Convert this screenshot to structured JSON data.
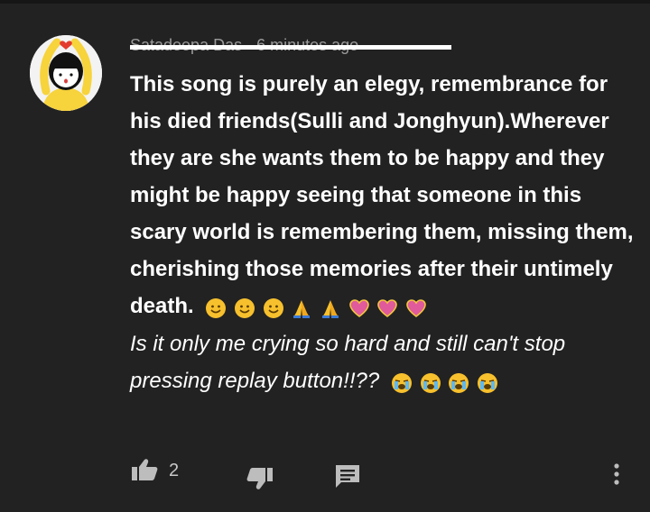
{
  "comment": {
    "author_line": "Satadeepa Das · 6 minutes ago",
    "body_text": "This song is purely an elegy, remembrance for his died friends(Sulli and Jonghyun).Wherever they are she wants them to be happy and they might be happy seeing that someone in this scary world is remembering them, missing them, cherishing those memories after their untimely death.",
    "body_emojis": [
      "smiley-emoji",
      "smiley-emoji",
      "smiley-emoji",
      "folded-hands-emoji",
      "folded-hands-emoji",
      "pink-heart-emoji",
      "pink-heart-emoji",
      "pink-heart-emoji"
    ],
    "followup_text": "Is it only me crying so hard and still can't stop pressing replay button!!??",
    "followup_emojis": [
      "crying-face-emoji",
      "crying-face-emoji",
      "crying-face-emoji",
      "crying-face-emoji"
    ]
  },
  "actions": {
    "like_count": "2",
    "like_icon": "thumbs-up-icon",
    "dislike_icon": "thumbs-down-icon",
    "reply_icon": "reply-icon",
    "more_icon": "more-vertical-icon"
  },
  "colors": {
    "background": "#222222",
    "text": "#ffffff",
    "icon": "#bdbdbd",
    "emoji_yellow": "#f7c02d",
    "heart_pink": "#e05a9c"
  }
}
